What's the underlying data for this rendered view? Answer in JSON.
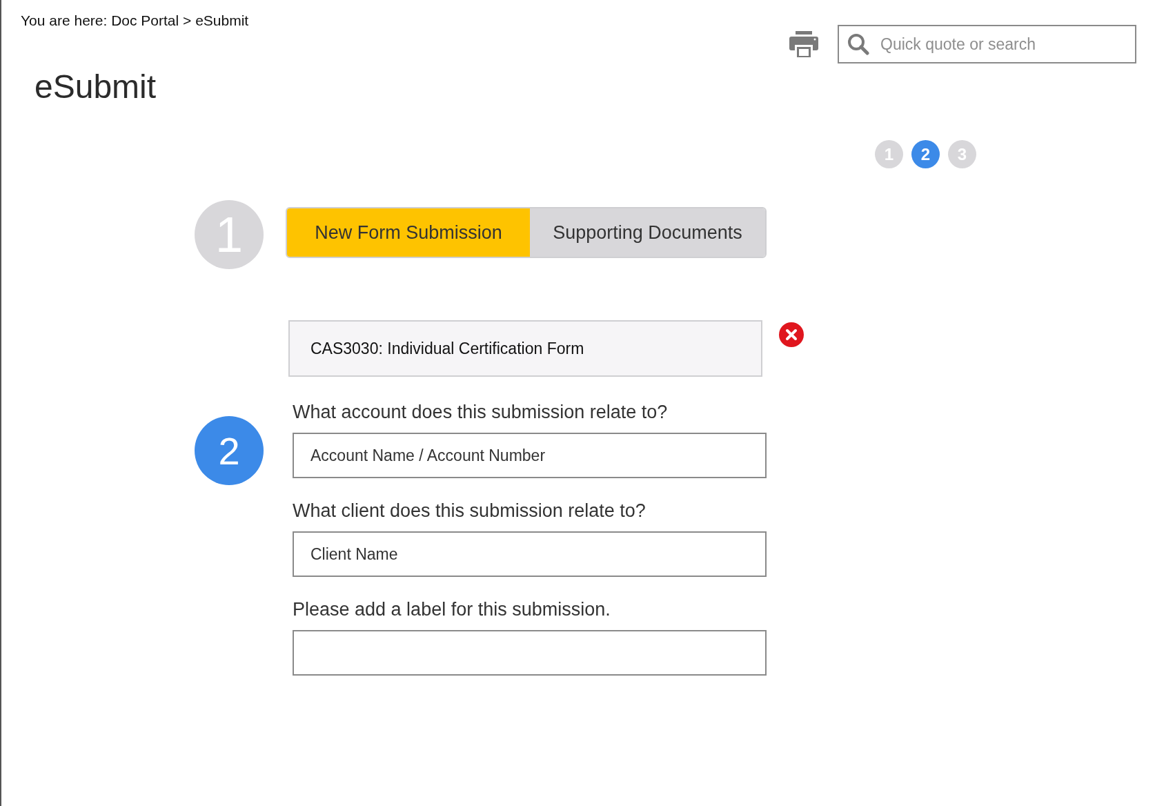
{
  "breadcrumb": "You are here: Doc Portal > eSubmit",
  "title": "eSubmit",
  "search": {
    "placeholder": "Quick quote or search"
  },
  "progress_dots": [
    {
      "label": "1",
      "selected": false
    },
    {
      "label": "2",
      "selected": true
    },
    {
      "label": "3",
      "selected": false
    }
  ],
  "step_one": {
    "number": "1",
    "active": false,
    "tabs": [
      {
        "label": "New Form Submission",
        "selected": true
      },
      {
        "label": "Supporting Documents",
        "selected": false
      }
    ],
    "selected_form": "CAS3030: Individual Certification Form"
  },
  "step_two": {
    "number": "2",
    "active": true,
    "fields": [
      {
        "label": "What account does this submission relate to?",
        "placeholder": "Account Name / Account Number"
      },
      {
        "label": "What client does this submission relate to?",
        "placeholder": "Client Name"
      },
      {
        "label": "Please add a label for this submission."
      }
    ]
  }
}
